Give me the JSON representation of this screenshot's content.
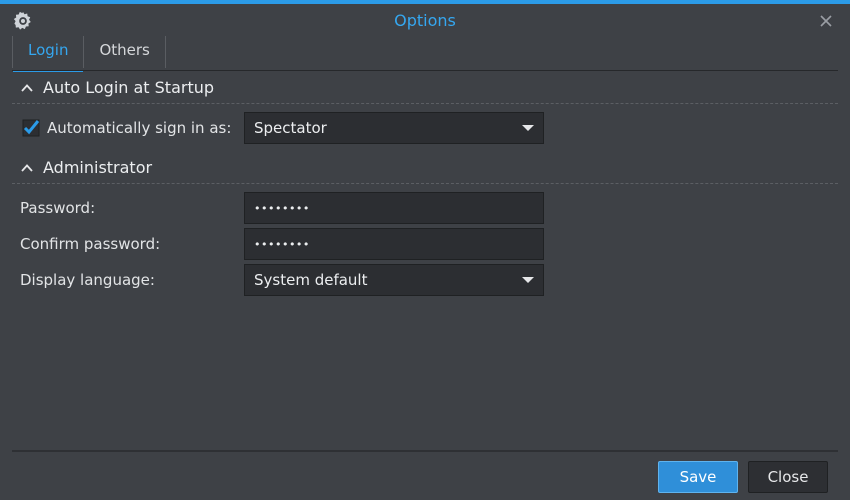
{
  "window": {
    "title": "Options",
    "accent": "#2b9be8",
    "background": "#3e4146"
  },
  "tabs": [
    {
      "label": "Login",
      "active": true
    },
    {
      "label": "Others",
      "active": false
    }
  ],
  "sections": {
    "auto_login": {
      "title": "Auto Login at Startup",
      "checkbox_label": "Automatically sign in as:",
      "checked": true,
      "account_value": "Spectator"
    },
    "administrator": {
      "title": "Administrator",
      "password_label": "Password:",
      "password_value": "••••••••",
      "confirm_label": "Confirm password:",
      "confirm_value": "••••••••",
      "language_label": "Display language:",
      "language_value": "System default"
    }
  },
  "buttons": {
    "save": "Save",
    "close": "Close"
  },
  "icons": {
    "app": "gear-icon",
    "close": "close-icon",
    "collapse": "chevron-up-icon",
    "dropdown": "caret-down-icon",
    "checkbox": "checkmark-icon"
  }
}
